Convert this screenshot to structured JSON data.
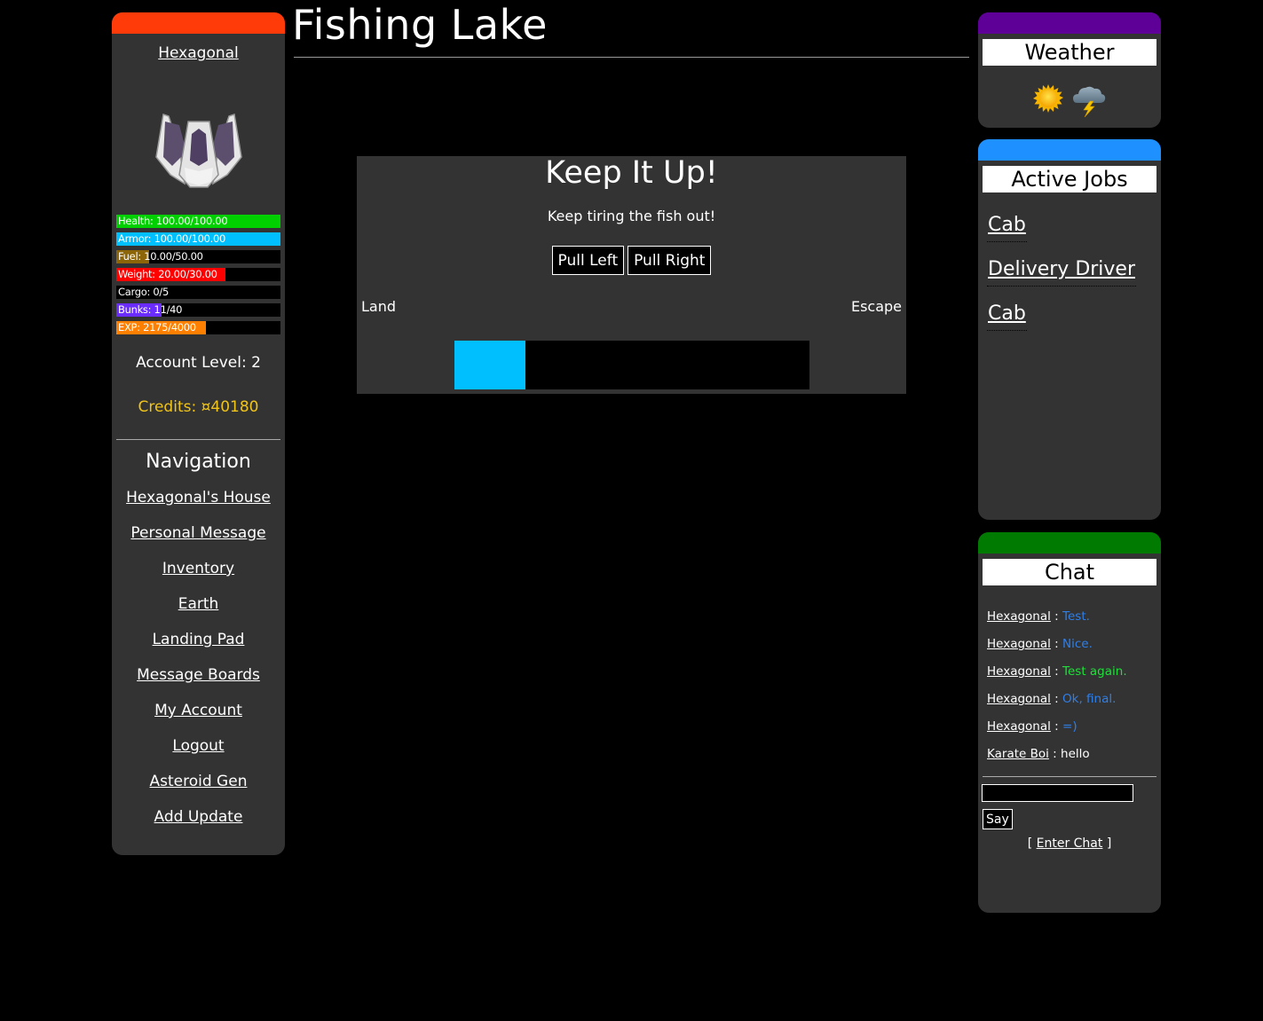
{
  "page": {
    "title": "Fishing Lake"
  },
  "sidebar": {
    "username": "Hexagonal",
    "avatar_icon": "ship-icon",
    "stats": [
      {
        "key": "health",
        "label": "Health: 100.00/100.00",
        "value": 100,
        "max": 100,
        "color": "#00d000"
      },
      {
        "key": "armor",
        "label": "Armor: 100.00/100.00",
        "value": 100,
        "max": 100,
        "color": "#00bfff"
      },
      {
        "key": "fuel",
        "label": "Fuel: 10.00/50.00",
        "value": 10,
        "max": 50,
        "color": "#8b6508"
      },
      {
        "key": "weight",
        "label": "Weight: 20.00/30.00",
        "value": 20,
        "max": 30,
        "color": "#ff0000"
      },
      {
        "key": "cargo",
        "label": "Cargo: 0/5",
        "value": 0,
        "max": 5,
        "color": "#808080"
      },
      {
        "key": "bunks",
        "label": "Bunks: 11/40",
        "value": 11,
        "max": 40,
        "color": "#6a2cff"
      },
      {
        "key": "exp",
        "label": "EXP: 2175/4000",
        "value": 2175,
        "max": 4000,
        "color": "#ff8000"
      }
    ],
    "account_level": "Account Level: 2",
    "credits": "Credits: ¤40180",
    "credits_color": "#f0c419",
    "nav_title": "Navigation",
    "nav_items": [
      "Hexagonal's House",
      "Personal Message",
      "Inventory",
      "Earth",
      "Landing Pad",
      "Message Boards",
      "My Account",
      "Logout",
      "Asteroid Gen",
      "Add Update"
    ],
    "accent": "#ff3b0a"
  },
  "game": {
    "heading": "Keep It Up!",
    "message": "Keep tiring the fish out!",
    "pull_left_label": "Pull Left",
    "pull_right_label": "Pull Right",
    "left_end_label": "Land",
    "right_end_label": "Escape",
    "tension_fraction": 0.2,
    "tension_color": "#00bfff"
  },
  "weather": {
    "title": "Weather",
    "accent": "#5e0098",
    "icons": [
      "sun-icon",
      "thunderstorm-icon"
    ]
  },
  "jobs": {
    "title": "Active Jobs",
    "accent": "#1e90ff",
    "items": [
      "Cab",
      "Delivery Driver",
      "Cab"
    ]
  },
  "chat": {
    "title": "Chat",
    "accent": "#007a00",
    "messages": [
      {
        "user": "Hexagonal",
        "text": "Test.",
        "color": "#2f7fe8"
      },
      {
        "user": "Hexagonal",
        "text": "Nice.",
        "color": "#2f7fe8"
      },
      {
        "user": "Hexagonal",
        "text": "Test again.",
        "color": "#1fe03a"
      },
      {
        "user": "Hexagonal",
        "text": "Ok, final.",
        "color": "#2f7fe8"
      },
      {
        "user": "Hexagonal",
        "text": "=)",
        "color": "#2f7fe8"
      },
      {
        "user": "Karate Boi",
        "text": "hello",
        "color": "#ffffff"
      }
    ],
    "separator": " : ",
    "input_value": "",
    "say_label": "Say",
    "enter_chat_open": "[ ",
    "enter_chat_label": "Enter Chat",
    "enter_chat_close": " ]"
  }
}
